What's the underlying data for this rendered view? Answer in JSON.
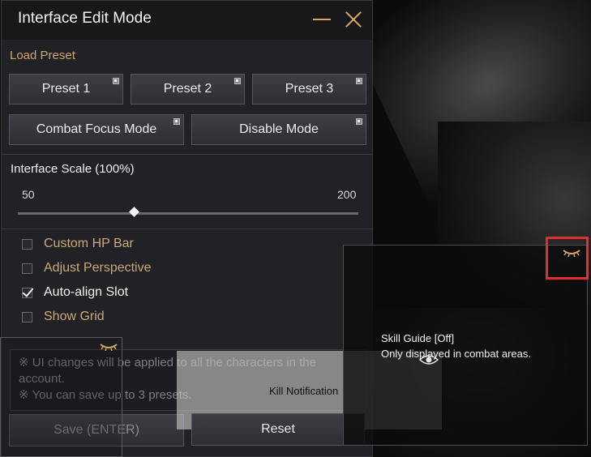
{
  "window": {
    "title": "Interface Edit Mode"
  },
  "load_preset": {
    "label": "Load Preset",
    "preset1": "Preset 1",
    "preset2": "Preset 2",
    "preset3": "Preset 3",
    "combat_focus": "Combat Focus Mode",
    "disable_mode": "Disable Mode"
  },
  "scale": {
    "label": "Interface Scale (100%)",
    "min": "50",
    "max": "200",
    "value": 100
  },
  "options": [
    {
      "label": "Custom HP Bar",
      "checked": false
    },
    {
      "label": "Adjust Perspective",
      "checked": false
    },
    {
      "label": "Auto-align Slot",
      "checked": true
    },
    {
      "label": "Show Grid",
      "checked": false
    }
  ],
  "notice": {
    "line1": "※ UI changes will be applied to all the characters in the account.",
    "line2": "※ You can save up to 3 presets."
  },
  "footer": {
    "save": "Save (ENTER)",
    "reset": "Reset"
  },
  "overlays": {
    "kill_notification": "Kill Notification",
    "skill_guide_title": "Skill Guide [Off]",
    "skill_guide_sub": "Only displayed in combat areas."
  },
  "colors": {
    "accent": "#d9a864",
    "highlight": "#e0302f"
  }
}
